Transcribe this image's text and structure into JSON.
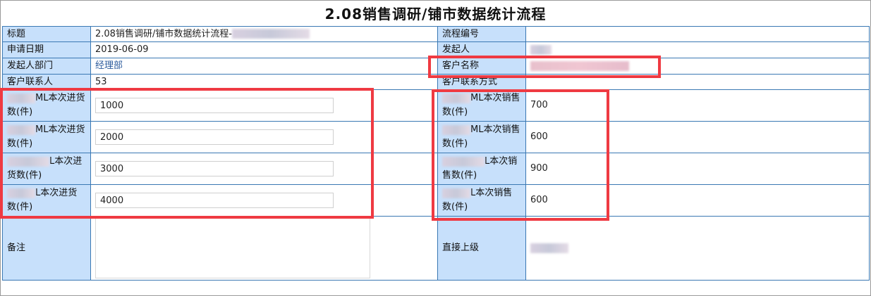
{
  "title": "2.08销售调研/铺市数据统计流程",
  "fields": {
    "title_label": "标题",
    "title_value": "2.08销售调研/铺市数据统计流程-",
    "process_no_label": "流程编号",
    "apply_date_label": "申请日期",
    "apply_date_value": "2019-06-09",
    "initiator_label": "发起人",
    "dept_label": "发起人部门",
    "dept_value": "经理部",
    "customer_name_label": "客户名称",
    "contact_label": "客户联系人",
    "contact_value": "53",
    "contact_method_label": "客户联系方式",
    "remark_label": "备注",
    "supervisor_label": "直接上级"
  },
  "purchases": [
    {
      "label": "ML本次进货数(件)",
      "value": "1000"
    },
    {
      "label": "ML本次进货数(件)",
      "value": "2000"
    },
    {
      "label": "L本次进货数(件)",
      "value": "3000"
    },
    {
      "label": "L本次进货数(件)",
      "value": "4000"
    }
  ],
  "sales": [
    {
      "label": "ML本次销售数(件)",
      "value": "700"
    },
    {
      "label": "ML本次销售数(件)",
      "value": "600"
    },
    {
      "label": "L本次销售数(件)",
      "value": "900"
    },
    {
      "label": "L本次销售数(件)",
      "value": "600"
    }
  ],
  "colors": {
    "highlight": "#ef3a42",
    "label_bg": "#c7e0fb",
    "border": "#3a78b3"
  }
}
